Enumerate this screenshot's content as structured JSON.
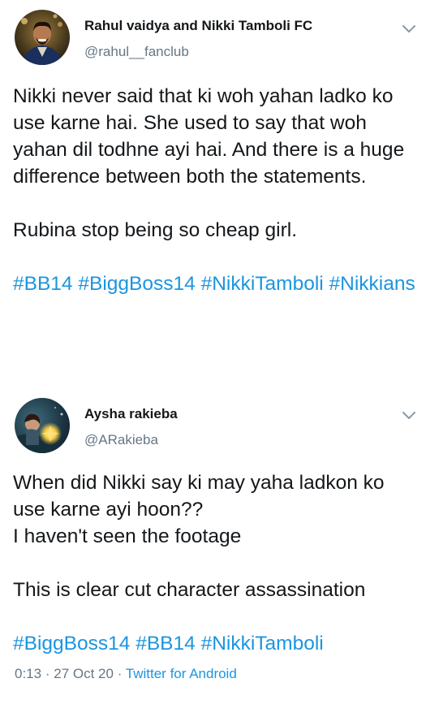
{
  "tweets": [
    {
      "display_name": "Rahul vaidya and Nikki Tamboli FC",
      "handle": "@rahul__fanclub",
      "paragraphs": [
        "Nikki never said that ki woh yahan ladko ko use karne hai. She used to say that woh yahan dil todhne ayi hai. And there is a huge difference between both the statements.",
        "Rubina stop being so cheap girl."
      ],
      "hashtags": [
        "#BB14",
        "#BiggBoss14",
        "#NikkiTamboli",
        "#Nikkians"
      ]
    },
    {
      "display_name": "Aysha rakieba",
      "handle": "@ARakieba",
      "paragraphs": [
        "When did Nikki say ki may yaha ladkon ko use karne ayi hoon??",
        "I haven't seen the footage",
        "This is clear cut character assassination"
      ],
      "hashtags": [
        "#BiggBoss14",
        "#BB14",
        "#NikkiTamboli"
      ],
      "meta": {
        "time": "0:13",
        "separator": "·",
        "date": "27 Oct 20",
        "client": "Twitter for Android"
      }
    }
  ],
  "icons": {
    "avatar_1": "profile-photo",
    "avatar_2": "profile-illustration",
    "chevron": "chevron-down-icon"
  },
  "colors": {
    "text": "#14171a",
    "secondary": "#657786",
    "link": "#1b95e0"
  }
}
